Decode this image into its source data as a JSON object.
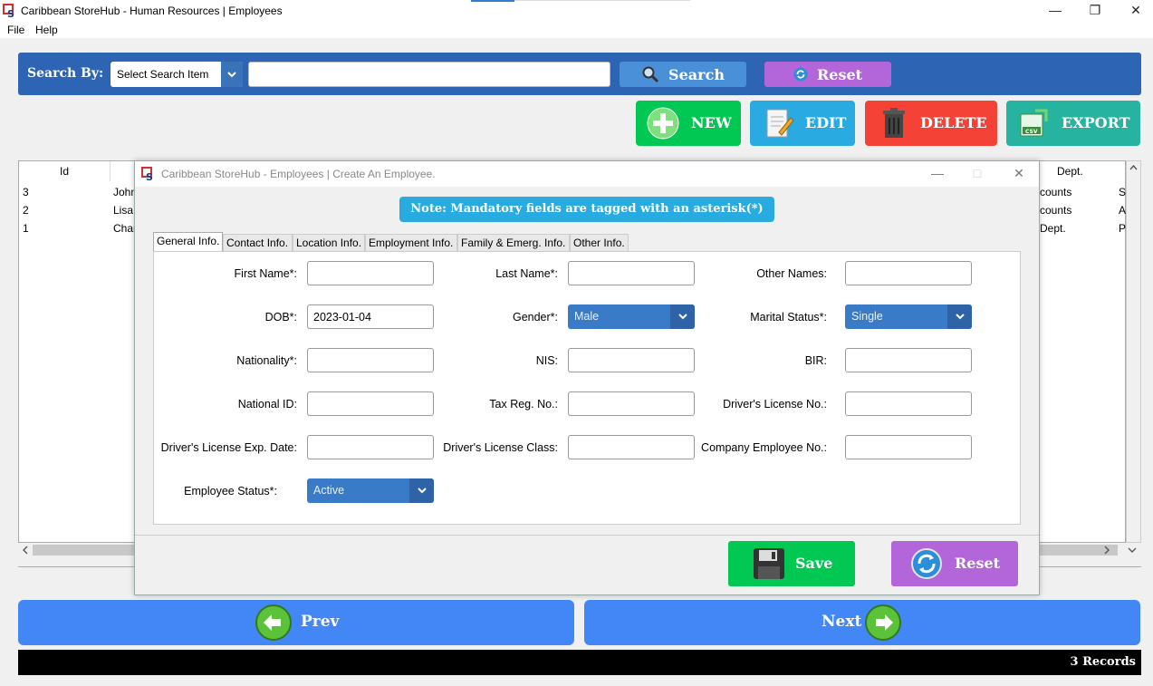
{
  "window": {
    "title": "Caribbean StoreHub - Human Resources | Employees",
    "controls": {
      "minimize": "—",
      "restore": "❐",
      "close": "✕"
    }
  },
  "menu": {
    "file": "File",
    "help": "Help"
  },
  "search": {
    "label": "Search By:",
    "select_value": "Select Search Item",
    "query": "",
    "search_button": "Search",
    "reset_button": "Reset"
  },
  "actions": {
    "new": "NEW",
    "edit": "EDIT",
    "delete": "DELETE",
    "export": "EXPORT"
  },
  "table": {
    "headers": {
      "id": "Id",
      "dept": "Dept."
    },
    "rows": [
      {
        "id": "3",
        "name": "John",
        "dept": "counts",
        "extra": "S"
      },
      {
        "id": "2",
        "name": "Lisa",
        "dept": "counts",
        "extra": "A"
      },
      {
        "id": "1",
        "name": "Char",
        "dept": "Dept.",
        "extra": "P"
      }
    ]
  },
  "dialog": {
    "title": "Caribbean StoreHub - Employees | Create An Employee.",
    "note": "Note: Mandatory fields are tagged with an asterisk(*)",
    "tabs": [
      "General Info.",
      "Contact Info.",
      "Location Info.",
      "Employment Info.",
      "Family & Emerg. Info.",
      "Other Info."
    ],
    "fields": {
      "first_name": {
        "label": "First Name*:",
        "value": ""
      },
      "last_name": {
        "label": "Last Name*:",
        "value": ""
      },
      "other_names": {
        "label": "Other Names:",
        "value": ""
      },
      "dob": {
        "label": "DOB*:",
        "value": "2023-01-04"
      },
      "gender": {
        "label": "Gender*:",
        "value": "Male"
      },
      "marital_status": {
        "label": "Marital Status*:",
        "value": "Single"
      },
      "nationality": {
        "label": "Nationality*:",
        "value": ""
      },
      "nis": {
        "label": "NIS:",
        "value": ""
      },
      "bir": {
        "label": "BIR:",
        "value": ""
      },
      "national_id": {
        "label": "National ID:",
        "value": ""
      },
      "tax_reg_no": {
        "label": "Tax Reg. No.:",
        "value": ""
      },
      "drivers_license_no": {
        "label": "Driver's License No.:",
        "value": ""
      },
      "drivers_license_exp": {
        "label": "Driver's License Exp. Date:",
        "value": ""
      },
      "drivers_license_class": {
        "label": "Driver's License Class:",
        "value": ""
      },
      "company_employee_no": {
        "label": "Company Employee No.:",
        "value": ""
      },
      "employee_status": {
        "label": "Employee Status*:",
        "value": "Active"
      }
    },
    "save_button": "Save",
    "reset_button": "Reset"
  },
  "nav": {
    "prev": "Prev",
    "next": "Next"
  },
  "status": {
    "records": "3 Records"
  },
  "colors": {
    "search_bar": "#2d64b3",
    "new": "#00c853",
    "edit": "#29abe2",
    "delete": "#f44336",
    "export": "#26b3a0",
    "search_button": "#4a90d9",
    "reset_button": "#b366d9",
    "nav": "#4287f5"
  },
  "icons": {
    "app": "storehub-logo-icon",
    "search": "magnifier-icon",
    "reset": "refresh-icon",
    "new": "plus-icon",
    "edit": "document-edit-icon",
    "delete": "trash-icon",
    "export": "csv-export-icon",
    "save": "floppy-disk-icon",
    "prev": "arrow-left-icon",
    "next": "arrow-right-icon"
  }
}
